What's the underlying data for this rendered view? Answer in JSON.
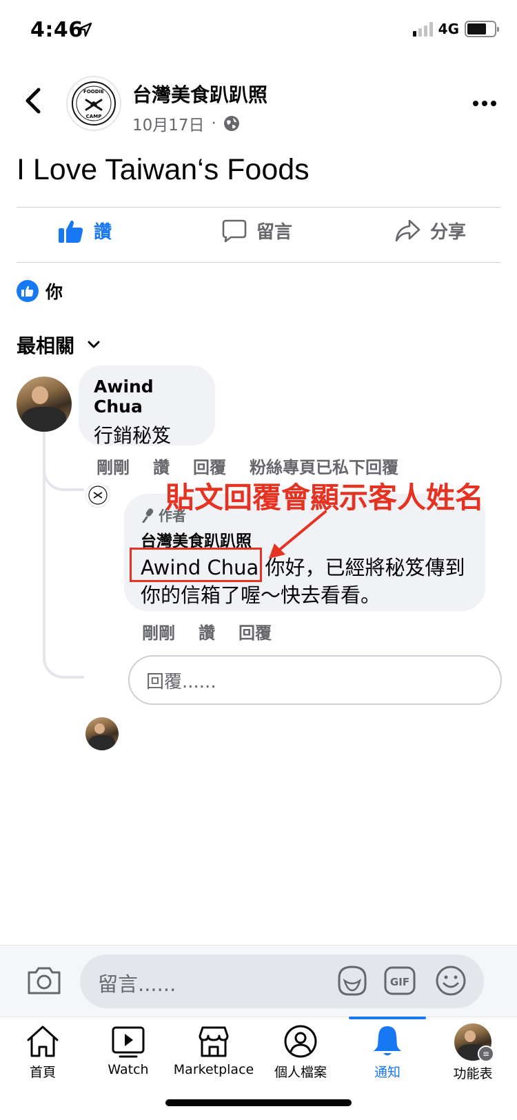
{
  "status": {
    "time": "4:46",
    "network": "4G"
  },
  "header": {
    "page_name": "台灣美食趴趴照",
    "date": "10月17日",
    "separator": "·",
    "logo_text_top": "FOODIE",
    "logo_text_bottom": "CAMP"
  },
  "post": {
    "text": "I Love Taiwan‘s Foods"
  },
  "actions": {
    "like": "讚",
    "comment": "留言",
    "share": "分享"
  },
  "reactions": {
    "who": "你"
  },
  "sort": {
    "label": "最相關"
  },
  "comments": [
    {
      "author": "Awind Chua",
      "text": "行銷秘笈",
      "time": "剛剛",
      "like": "讚",
      "reply": "回覆",
      "status": "粉絲專頁已私下回覆"
    }
  ],
  "reply": {
    "tag": "作者",
    "author": "台灣美食趴趴照",
    "mention": "Awind Chua",
    "text_after_mention": " 你好，已經將秘笈傳到你的信箱了喔～快去看看。",
    "time": "剛剛",
    "like": "讚",
    "reply": "回覆"
  },
  "annotation": {
    "text": "貼文回覆會顯示客人姓名",
    "color": "#e53323"
  },
  "compose": {
    "placeholder": "回覆......"
  },
  "comment_bar": {
    "placeholder": "留言......",
    "gif": "GIF"
  },
  "tabs": [
    {
      "label": "首頁",
      "icon": "home-icon"
    },
    {
      "label": "Watch",
      "icon": "watch-icon"
    },
    {
      "label": "Marketplace",
      "icon": "marketplace-icon"
    },
    {
      "label": "個人檔案",
      "icon": "profile-icon"
    },
    {
      "label": "通知",
      "icon": "bell-icon",
      "active": true
    },
    {
      "label": "功能表",
      "icon": "menu-icon"
    }
  ],
  "colors": {
    "accent": "#1877f2",
    "annotation": "#e53323",
    "muted": "#65676b",
    "bubble": "#f0f2f5"
  }
}
